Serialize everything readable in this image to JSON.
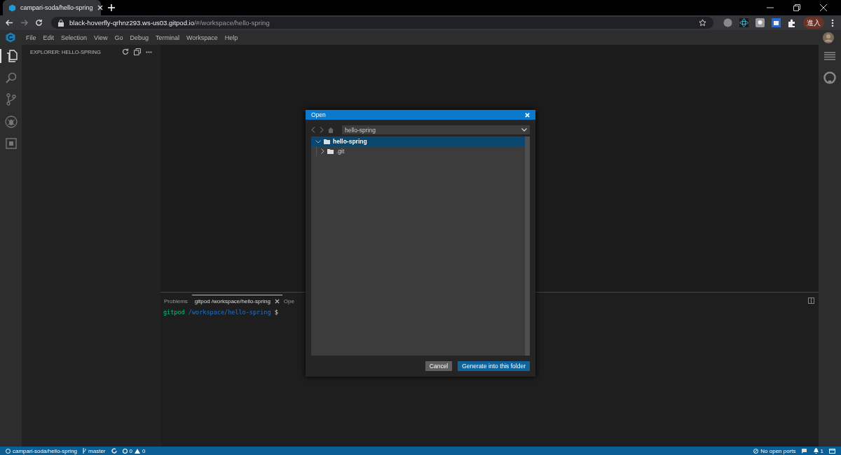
{
  "browser": {
    "tabs": [
      {
        "title": "campari-soda/hello-spring",
        "selected": true
      }
    ],
    "url_host": "black-hoverfly-qrhnz293.ws-us03.gitpod.io",
    "url_path": "/#/workspace/hello-spring",
    "profile": "進入"
  },
  "menu": [
    "File",
    "Edit",
    "Selection",
    "View",
    "Go",
    "Debug",
    "Terminal",
    "Workspace",
    "Help"
  ],
  "activity": [
    {
      "kind": "files",
      "selected": true
    },
    {
      "kind": "search",
      "selected": false
    },
    {
      "kind": "scm",
      "selected": false
    },
    {
      "kind": "debug",
      "selected": false
    },
    {
      "kind": "extensions",
      "selected": false
    }
  ],
  "sidebar": {
    "title": "EXPLORER: HELLO-SPRING"
  },
  "panel": {
    "tabs": [
      {
        "label": "Problems",
        "selected": false,
        "closable": false
      },
      {
        "label": "gitpod /workspace/hello-spring",
        "selected": true,
        "closable": true
      },
      {
        "label": "Ope",
        "selected": false,
        "closable": false
      }
    ],
    "prompt_user": "gitpod",
    "prompt_path": "/workspace/hello-spring",
    "prompt_sign": "$"
  },
  "dialog": {
    "title": "Open",
    "location": "hello-spring",
    "tree": [
      {
        "name": "hello-spring",
        "expanded": true,
        "selected": true,
        "children": [
          {
            "name": ".git",
            "expanded": false,
            "selected": false
          }
        ]
      }
    ],
    "buttons": [
      {
        "label": "Cancel",
        "kind": "secondary"
      },
      {
        "label": "Generate into this folder",
        "kind": "primary"
      }
    ]
  },
  "status_bar": {
    "repo": "campari-soda/hello-spring",
    "branch": "master",
    "errors": "0",
    "warnings": "0",
    "ports": "No open ports",
    "notifications": "1"
  }
}
